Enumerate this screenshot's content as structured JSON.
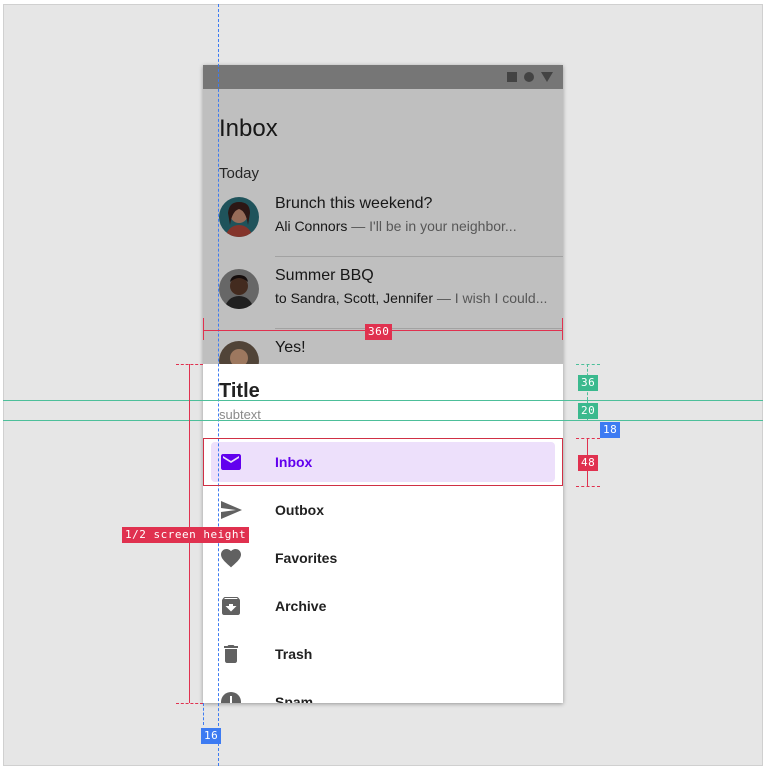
{
  "app": {
    "title": "Inbox",
    "section": "Today"
  },
  "messages": [
    {
      "subject": "Brunch this weekend?",
      "sender": "Ali Connors",
      "preview": " — I'll be in your neighbor..."
    },
    {
      "subject": "Summer BBQ",
      "sender": "to Sandra, Scott, Jennifer",
      "preview": " — I wish I could..."
    },
    {
      "subject": "Yes!",
      "sender": "",
      "preview": ""
    }
  ],
  "sheet": {
    "title": "Title",
    "subtitle": "subtext",
    "items": [
      {
        "label": "Inbox",
        "icon": "mail-icon",
        "active": true
      },
      {
        "label": "Outbox",
        "icon": "send-icon",
        "active": false
      },
      {
        "label": "Favorites",
        "icon": "heart-icon",
        "active": false
      },
      {
        "label": "Archive",
        "icon": "archive-icon",
        "active": false
      },
      {
        "label": "Trash",
        "icon": "trash-icon",
        "active": false
      },
      {
        "label": "Spam",
        "icon": "alert-icon",
        "active": false
      }
    ]
  },
  "annotations": {
    "width": "360",
    "half_height": "1/2 screen height",
    "header_height": "36",
    "title_gap": "20",
    "list_top_gap": "18",
    "item_height": "48",
    "side_margin": "16"
  },
  "colors": {
    "accent": "#6200ee",
    "active_bg": "#ede0fb",
    "annotation_red": "#e0314f",
    "annotation_green": "#3bb98e",
    "annotation_blue": "#3d7bf2"
  }
}
